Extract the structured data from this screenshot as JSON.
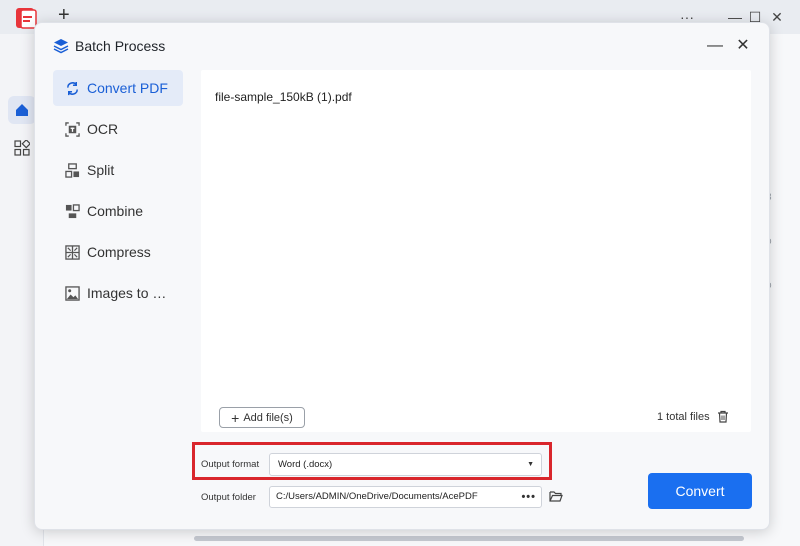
{
  "app": {
    "new_tab_glyph": "+",
    "window_controls": {
      "more": "···",
      "minimize": "—",
      "maximize": "☐",
      "close": "✕"
    },
    "faint_edge_chars": [
      "3",
      "o",
      "o"
    ]
  },
  "dialog": {
    "title": "Batch Process",
    "minimize_glyph": "—",
    "close_glyph": "✕"
  },
  "tools": [
    {
      "label": "Convert PDF",
      "icon": "convert-icon",
      "active": true
    },
    {
      "label": "OCR",
      "icon": "ocr-icon",
      "active": false
    },
    {
      "label": "Split",
      "icon": "split-icon",
      "active": false
    },
    {
      "label": "Combine",
      "icon": "combine-icon",
      "active": false
    },
    {
      "label": "Compress",
      "icon": "compress-icon",
      "active": false
    },
    {
      "label": "Images to …",
      "icon": "images-icon",
      "active": false
    }
  ],
  "files": {
    "items": [
      "file-sample_150kB (1).pdf"
    ],
    "add_label": "Add file(s)",
    "total_label": "1 total files"
  },
  "output": {
    "format_label": "Output format",
    "format_value": "Word (.docx)",
    "folder_label": "Output folder",
    "folder_value": "C:/Users/ADMIN/OneDrive/Documents/AcePDF",
    "folder_more": "•••"
  },
  "convert_label": "Convert",
  "colors": {
    "accent": "#1a6ff0",
    "active_bg": "#e4ebf8",
    "highlight": "#d9262c"
  }
}
